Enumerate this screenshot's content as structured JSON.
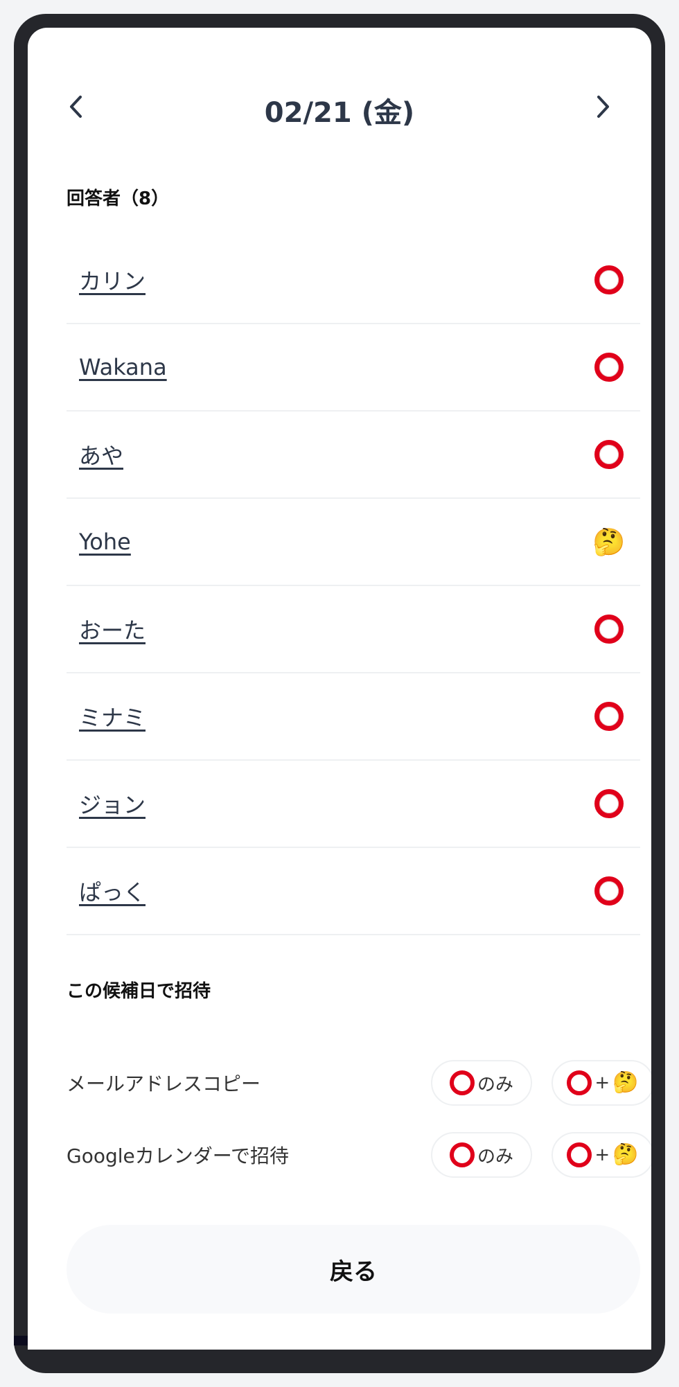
{
  "header": {
    "title": "02/21 (金)",
    "prev_icon": "chevron-left-icon",
    "next_icon": "chevron-right-icon"
  },
  "respondents": {
    "title": "回答者（8）",
    "items": [
      {
        "name": "カリン",
        "status": "circle"
      },
      {
        "name": "Wakana",
        "status": "circle"
      },
      {
        "name": "あや",
        "status": "circle"
      },
      {
        "name": "Yohe",
        "status": "thinking"
      },
      {
        "name": "おーた",
        "status": "circle"
      },
      {
        "name": "ミナミ",
        "status": "circle"
      },
      {
        "name": "ジョン",
        "status": "circle"
      },
      {
        "name": "ぱっく",
        "status": "circle"
      }
    ]
  },
  "invite": {
    "title": "この候補日で招待",
    "rows": [
      {
        "label": "メールアドレスコピー",
        "only_label": "のみ",
        "plus_label": "+"
      },
      {
        "label": "Googleカレンダーで招待",
        "only_label": "のみ",
        "plus_label": "+"
      }
    ]
  },
  "back_button": {
    "label": "戻る"
  },
  "colors": {
    "circle": "#e0001a",
    "text": "#2d3748",
    "divider": "#eef0f2"
  }
}
